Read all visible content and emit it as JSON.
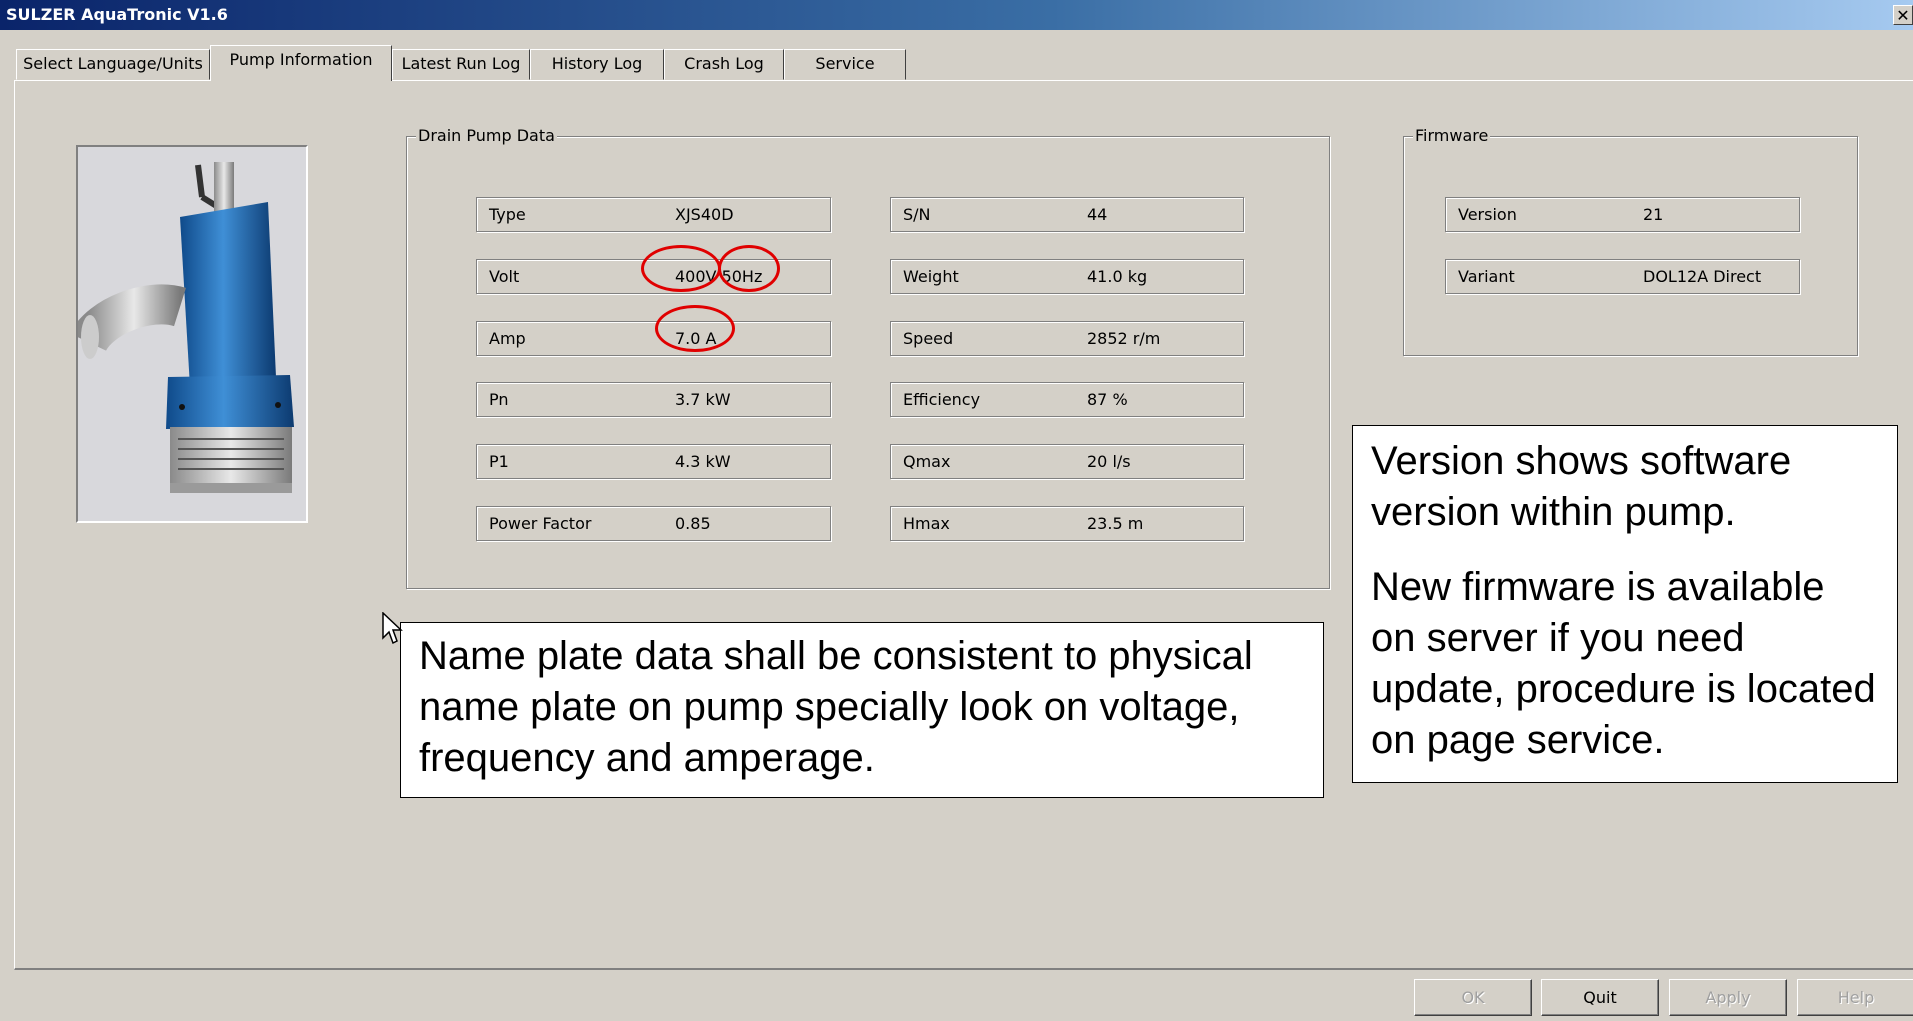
{
  "window": {
    "title": "SULZER AquaTronic V1.6",
    "close_glyph": "✕"
  },
  "tabs": [
    {
      "label": "Select Language/Units",
      "active": false
    },
    {
      "label": "Pump Information",
      "active": true
    },
    {
      "label": "Latest Run Log",
      "active": false
    },
    {
      "label": "History Log",
      "active": false
    },
    {
      "label": "Crash Log",
      "active": false
    },
    {
      "label": "Service",
      "active": false
    }
  ],
  "drain_pump_data": {
    "title": "Drain Pump Data",
    "left": [
      {
        "label": "Type",
        "value": "XJS40D"
      },
      {
        "label": "Volt",
        "value": "400V 50Hz"
      },
      {
        "label": "Amp",
        "value": "7.0 A"
      },
      {
        "label": "Pn",
        "value": "3.7 kW"
      },
      {
        "label": "P1",
        "value": "4.3 kW"
      },
      {
        "label": "Power Factor",
        "value": "0.85"
      }
    ],
    "right": [
      {
        "label": "S/N",
        "value": "44"
      },
      {
        "label": "Weight",
        "value": "41.0 kg"
      },
      {
        "label": "Speed",
        "value": "2852 r/m"
      },
      {
        "label": "Efficiency",
        "value": "87 %"
      },
      {
        "label": "Qmax",
        "value": "20 l/s"
      },
      {
        "label": "Hmax",
        "value": "23.5 m"
      }
    ]
  },
  "firmware": {
    "title": "Firmware",
    "fields": [
      {
        "label": "Version",
        "value": "21"
      },
      {
        "label": "Variant",
        "value": "DOL12A Direct"
      }
    ]
  },
  "callouts": {
    "nameplate": "Name plate data shall be consistent to physical name plate on pump specially look on voltage, frequency and amperage.",
    "version_p1": "Version shows software version within pump.",
    "version_p2": "New firmware is available on server if you need update, procedure is located on page service."
  },
  "buttons": {
    "ok": {
      "label": "OK",
      "enabled": false
    },
    "quit": {
      "label": "Quit",
      "enabled": true
    },
    "apply": {
      "label": "Apply",
      "enabled": false
    },
    "help": {
      "label": "Help",
      "enabled": false
    }
  },
  "colors": {
    "titlebar_start": "#0a246a",
    "titlebar_end": "#a6caf0",
    "window_bg": "#d4d0c8",
    "highlight_circle": "#e00000",
    "pump_blue": "#2a6fb5"
  },
  "icons": {
    "cursor": "arrow-cursor-icon",
    "pump": "submersible-pump-image"
  }
}
